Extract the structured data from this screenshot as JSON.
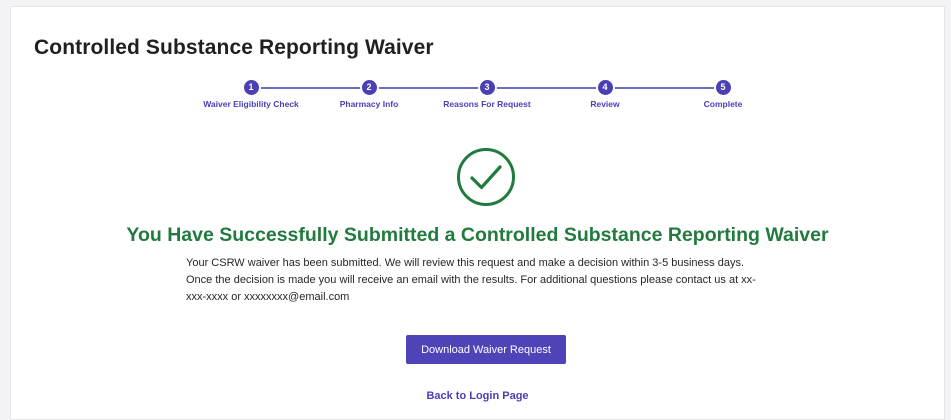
{
  "page": {
    "title": "Controlled Substance Reporting Waiver"
  },
  "stepper": {
    "steps": [
      {
        "number": "1",
        "label": "Waiver Eligibility Check"
      },
      {
        "number": "2",
        "label": "Pharmacy Info"
      },
      {
        "number": "3",
        "label": "Reasons For Request"
      },
      {
        "number": "4",
        "label": "Review"
      },
      {
        "number": "5",
        "label": "Complete"
      }
    ]
  },
  "success": {
    "icon": "check-circle-icon",
    "heading": "You Have Successfully Submitted a Controlled Substance Reporting Waiver",
    "message": "Your CSRW waiver has been submitted. We will review this request and make a decision within 3-5 business days. Once the decision is made you will receive an email with the results. For additional questions please contact us at xx-xxx-xxxx or xxxxxxxx@email.com"
  },
  "actions": {
    "download_label": "Download Waiver Request",
    "back_label": "Back to Login Page"
  },
  "colors": {
    "accent": "#4f43b8",
    "success": "#217a3e"
  }
}
